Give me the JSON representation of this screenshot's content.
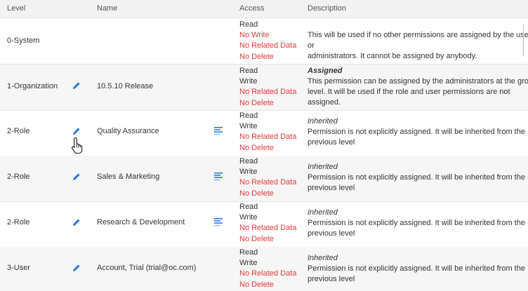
{
  "header": {
    "level": "Level",
    "name": "Name",
    "access": "Access",
    "description": "Description"
  },
  "rows": [
    {
      "level": "0-System",
      "name": "",
      "access": [
        "Read",
        "No Write",
        "No Related Data",
        "No Delete"
      ],
      "status": "",
      "description": [
        "This will be used if no other permissions are assigned by the users or",
        "administrators. It cannot be assigned by anybody."
      ]
    },
    {
      "level": "1-Organization",
      "name": "10.5.10 Release",
      "access": [
        "Read",
        "Write",
        "No Related Data",
        "No Delete"
      ],
      "status": "Assigned",
      "description": [
        "This permission can be assigned by the administrators at the group",
        "level. It will be used if the role and user permissions are not",
        "assigned."
      ]
    },
    {
      "level": "2-Role",
      "name": "Quality Assurance",
      "access": [
        "Read",
        "Write",
        "No Related Data",
        "No Delete"
      ],
      "status": "Inherited",
      "description": [
        "Permission is not explicitly assigned. It will be inherited from the",
        "previous level"
      ]
    },
    {
      "level": "2-Role",
      "name": "Sales & Marketing",
      "access": [
        "Read",
        "Write",
        "No Related Data",
        "No Delete"
      ],
      "status": "Inherited",
      "description": [
        "Permission is not explicitly assigned. It will be inherited from the",
        "previous level"
      ]
    },
    {
      "level": "2-Role",
      "name": "Research & Development",
      "access": [
        "Read",
        "Write",
        "No Related Data",
        "No Delete"
      ],
      "status": "Inherited",
      "description": [
        "Permission is not explicitly assigned. It will be inherited from the",
        "previous level"
      ]
    },
    {
      "level": "3-User",
      "name": "Account, Trial (trial@oc.com)",
      "access": [
        "Read",
        "Write",
        "No Related Data",
        "No Delete"
      ],
      "status": "Inherited",
      "description": [
        "Permission is not explicitly assigned. It will be inherited from the",
        "previous level"
      ]
    }
  ],
  "colors": {
    "accent": "#2e7bd6",
    "deny": "#e23b3b",
    "header_bg": "#f2f2f2",
    "alt_row_bg": "#f6f6f6"
  }
}
